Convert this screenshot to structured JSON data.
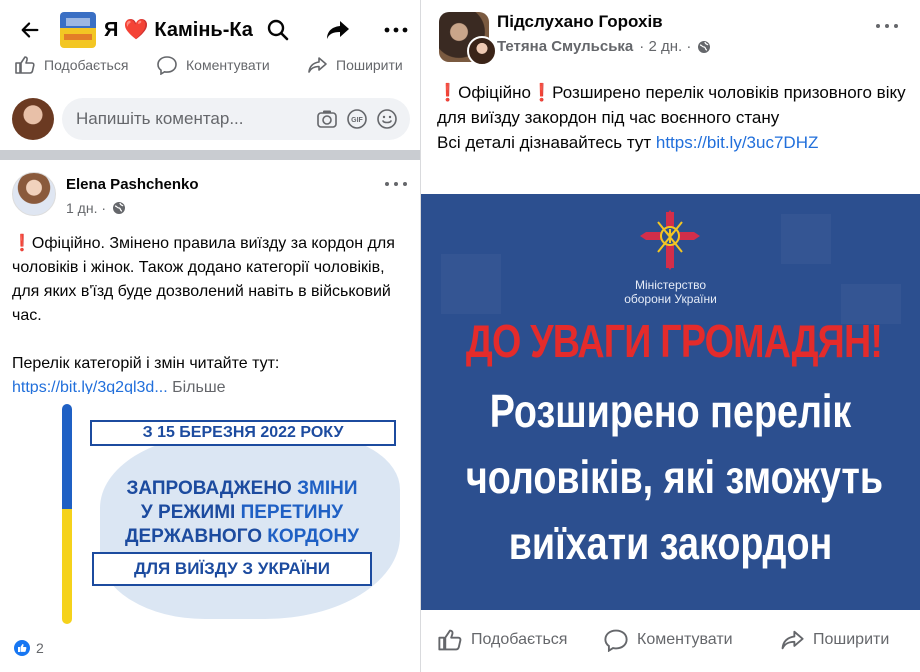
{
  "left": {
    "group_title": "Я ❤️ Камінь-Ка...",
    "top_actions": {
      "like": "Подобається",
      "comment": "Коментувати",
      "share": "Поширити"
    },
    "comment_placeholder": "Напишіть коментар...",
    "post": {
      "author": "Elena Pashchenko",
      "time": "1 дн. ·",
      "text_line1": "Офіційно. Змінено правила виїзду за кордон для чоловіків і жінок. Також додано категорії чоловіків, для яких в'їзд буде дозволений навіть в військовий час.",
      "text_line2": "Перелік категорій і змін читайте тут:",
      "link": "https://bit.ly/3q2ql3d...",
      "more": "Більше",
      "image": {
        "date": "З 15 БЕРЕЗНЯ 2022 РОКУ",
        "line1_a": "ЗАПРОВАДЖЕНО ",
        "line1_b": "ЗМІНИ",
        "line2_a": "У РЕЖИМІ ",
        "line2_b": "ПЕРЕТИНУ",
        "line3_a": "ДЕРЖАВНОГО ",
        "line3_b": "КОРДОНУ",
        "line4": "ДЛЯ ВИЇЗДУ З УКРАЇНИ"
      },
      "reaction_count": "2"
    }
  },
  "right": {
    "group_name": "Підслухано Горохів",
    "author": "Тетяна Смульська",
    "time": "· 2 дн. ·",
    "text_main": "Офіційно❗Розширено перелік  чоловіків призовного віку для виїзду закордон під час воєнного стану",
    "text_details": "Всі деталі дізнавайтесь тут ",
    "link": "https://bit.ly/3uc7DHZ",
    "image": {
      "ministry_line1": "Міністерство",
      "ministry_line2": "оборони України",
      "headline_red": "ДО УВАГИ ГРОМАДЯН!",
      "headline_1": "Розширено перелік",
      "headline_2": "чоловіків, які зможуть",
      "headline_3": "виїхати закордон"
    },
    "actions": {
      "like": "Подобається",
      "comment": "Коментувати",
      "share": "Поширити"
    }
  },
  "colors": {
    "facebook_blue": "#1877f2",
    "link": "#216fdb",
    "poster_bg": "#2c4f8f",
    "poster_red": "#e42b2b"
  }
}
